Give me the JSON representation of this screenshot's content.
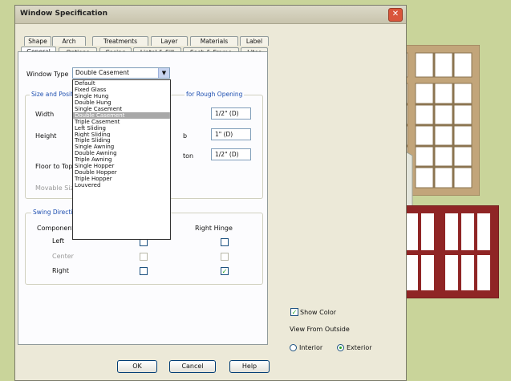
{
  "window": {
    "title": "Window Specification",
    "close_glyph": "✕"
  },
  "tabs_top": [
    "Shape",
    "Arch",
    "Treatments",
    "Layer",
    "Materials",
    "Label"
  ],
  "tabs_bottom": [
    "General",
    "Options",
    "Casing",
    "Lintel & Sill",
    "Sash & Frame",
    "Lites"
  ],
  "general": {
    "window_type_label": "Window Type",
    "window_type_value": "Double Casement",
    "dropdown_arrow": "▼",
    "size_group_label": "Size and Position",
    "rough_opening_label": "for Rough Opening",
    "width_label": "Width",
    "height_label": "Height",
    "floor_to_top_label": "Floor to Top",
    "movable_size_label": "Movable Size",
    "rough_suffix_b": "b",
    "rough_suffix_c": "ton",
    "rough_values": [
      "1/2\" (D)",
      "1\" (D)",
      "1/2\" (D)"
    ]
  },
  "window_types": [
    "Default",
    "Fixed Glass",
    "Single Hung",
    "Double Hung",
    "Single Casement",
    "Double Casement",
    "Triple Casement",
    "Left Sliding",
    "Right Sliding",
    "Triple Sliding",
    "Single Awning",
    "Double Awning",
    "Triple Awning",
    "Single Hopper",
    "Double Hopper",
    "Triple Hopper",
    "Louvered"
  ],
  "selected_type_index": 5,
  "swing": {
    "group_label": "Swing Direction",
    "component_label": "Component Opt",
    "right_hinge_label": "Right Hinge",
    "rows": [
      "Left",
      "Center",
      "Right"
    ],
    "check_glyph": "✓"
  },
  "view_options": {
    "show_color_label": "Show Color",
    "view_from_label": "View From Outside",
    "interior_label": "Interior",
    "exterior_label": "Exterior"
  },
  "buttons": {
    "ok": "OK",
    "cancel": "Cancel",
    "help": "Help"
  },
  "colors": {
    "frame_tan": "#c2a57a",
    "frame_white": "#e4e6dc",
    "frame_red": "#8f2525",
    "accent_blue": "#1e4fb0"
  }
}
